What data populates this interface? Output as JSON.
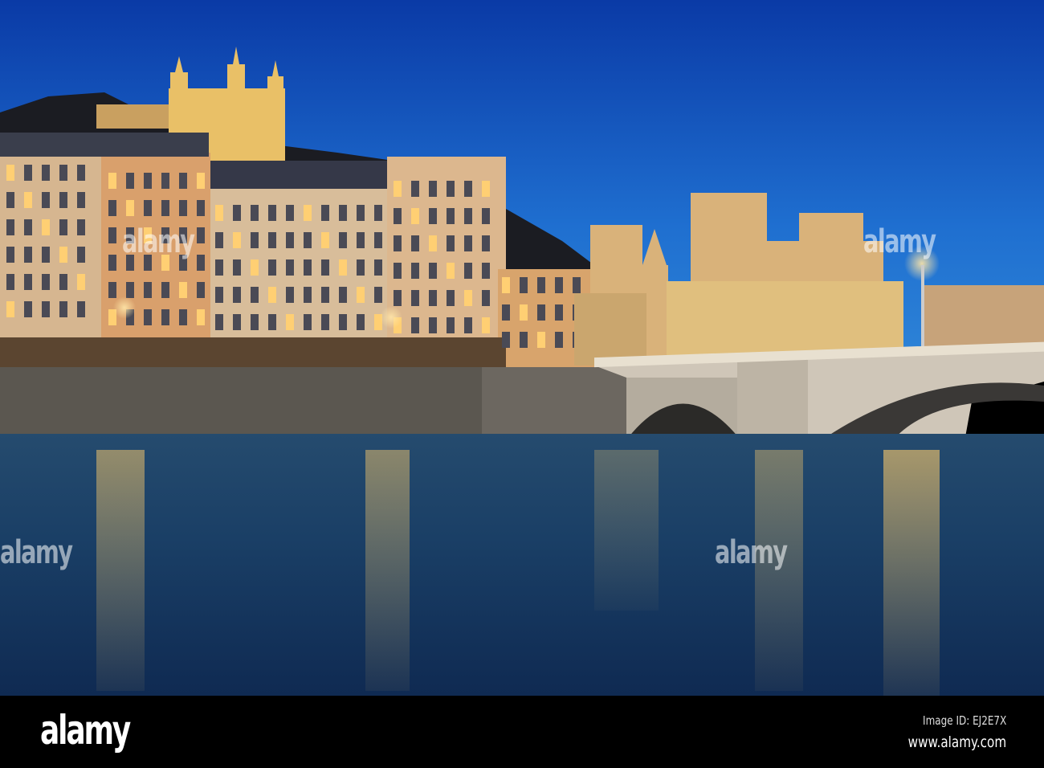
{
  "photo": {
    "subject": "Lyon riverside at dusk",
    "watermark_text": "alamy",
    "colors": {
      "sky_top": "#0a3fa8",
      "sky_bottom": "#2c7fd6",
      "water": "#13355e",
      "light": "#ffd37a"
    }
  },
  "footer": {
    "logo": "alamy",
    "image_id": "Image ID: EJ2E7X",
    "url": "www.alamy.com"
  }
}
